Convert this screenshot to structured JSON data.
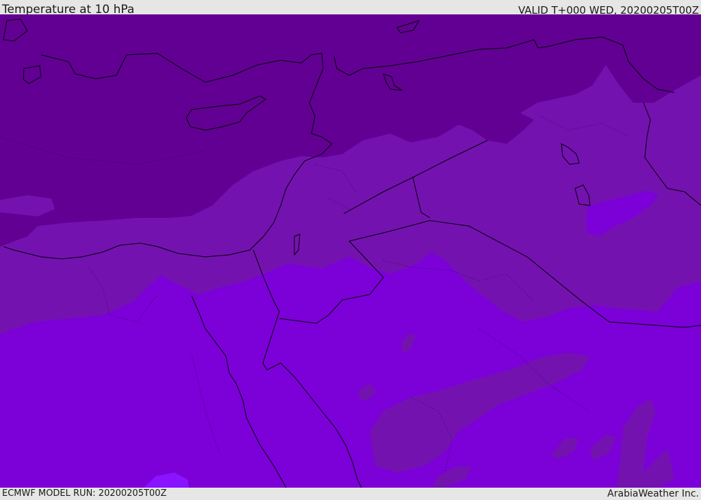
{
  "header": {
    "title": "Temperature at 10 hPa",
    "valid": "VALID T+000 WED, 20200205T00Z"
  },
  "footer": {
    "model_run": "ECMWF MODEL RUN: 20200205T00Z",
    "credit": "ArabiaWeather Inc."
  },
  "map": {
    "fill_levels": [
      {
        "level": "coldest",
        "color": "#620093"
      },
      {
        "level": "mid",
        "color": "#7412b0"
      },
      {
        "level": "warm",
        "color": "#7c00d8"
      },
      {
        "level": "warmest",
        "color": "#8a14ff"
      }
    ],
    "coastline_color": "#000000"
  }
}
